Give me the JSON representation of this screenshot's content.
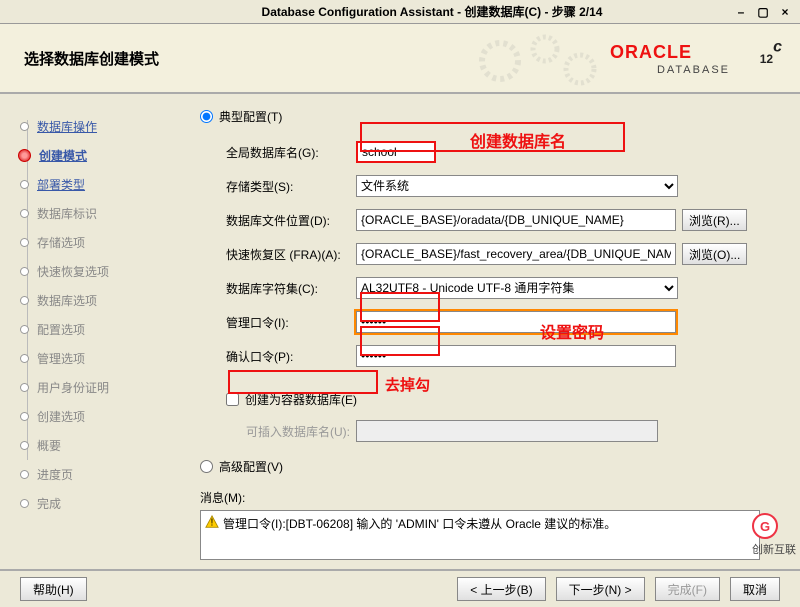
{
  "window": {
    "title": "Database Configuration Assistant - 创建数据库(C) - 步骤 2/14"
  },
  "header": {
    "title": "选择数据库创建模式",
    "brand": "ORACLE",
    "product": "DATABASE",
    "version": "12",
    "suffix": "c"
  },
  "sidebar": {
    "items": [
      {
        "label": "数据库操作",
        "type": "link"
      },
      {
        "label": "创建模式",
        "type": "active"
      },
      {
        "label": "部署类型",
        "type": "link"
      },
      {
        "label": "数据库标识",
        "type": "dim"
      },
      {
        "label": "存储选项",
        "type": "dim"
      },
      {
        "label": "快速恢复选项",
        "type": "dim"
      },
      {
        "label": "数据库选项",
        "type": "dim"
      },
      {
        "label": "配置选项",
        "type": "dim"
      },
      {
        "label": "管理选项",
        "type": "dim"
      },
      {
        "label": "用户身份证明",
        "type": "dim"
      },
      {
        "label": "创建选项",
        "type": "dim"
      },
      {
        "label": "概要",
        "type": "dim"
      },
      {
        "label": "进度页",
        "type": "dim"
      },
      {
        "label": "完成",
        "type": "dim"
      }
    ]
  },
  "main": {
    "typical_label": "典型配置(T)",
    "global_db_label": "全局数据库名(G):",
    "global_db_value": "school",
    "annot_dbname": "创建数据库名",
    "storage_label": "存储类型(S):",
    "storage_value": "文件系统",
    "file_loc_label": "数据库文件位置(D):",
    "file_loc_value": "{ORACLE_BASE}/oradata/{DB_UNIQUE_NAME}",
    "browse_r": "浏览(R)...",
    "fra_label": "快速恢复区 (FRA)(A):",
    "fra_value": "{ORACLE_BASE}/fast_recovery_area/{DB_UNIQUE_NAME}",
    "browse_o": "浏览(O)...",
    "charset_label": "数据库字符集(C):",
    "charset_value": "AL32UTF8 - Unicode UTF-8 通用字符集",
    "admin_pw_label": "管理口令(I):",
    "admin_pw_value": "••••••",
    "confirm_pw_label": "确认口令(P):",
    "confirm_pw_value": "••••••",
    "annot_pw": "设置密码",
    "cdb_label": "创建为容器数据库(E)",
    "annot_uncheck": "去掉勾",
    "pdb_label": "可插入数据库名(U):",
    "advanced_label": "高级配置(V)",
    "msg_label": "消息(M):",
    "msg_text": "管理口令(I):[DBT-06208] 输入的 'ADMIN' 口令未遵从 Oracle 建议的标准。"
  },
  "footer": {
    "help": "帮助(H)",
    "back": "< 上一步(B)",
    "next": "下一步(N) >",
    "finish": "完成(F)",
    "cancel": "取消"
  },
  "watermark": {
    "badge": "G",
    "text": "创新互联"
  }
}
